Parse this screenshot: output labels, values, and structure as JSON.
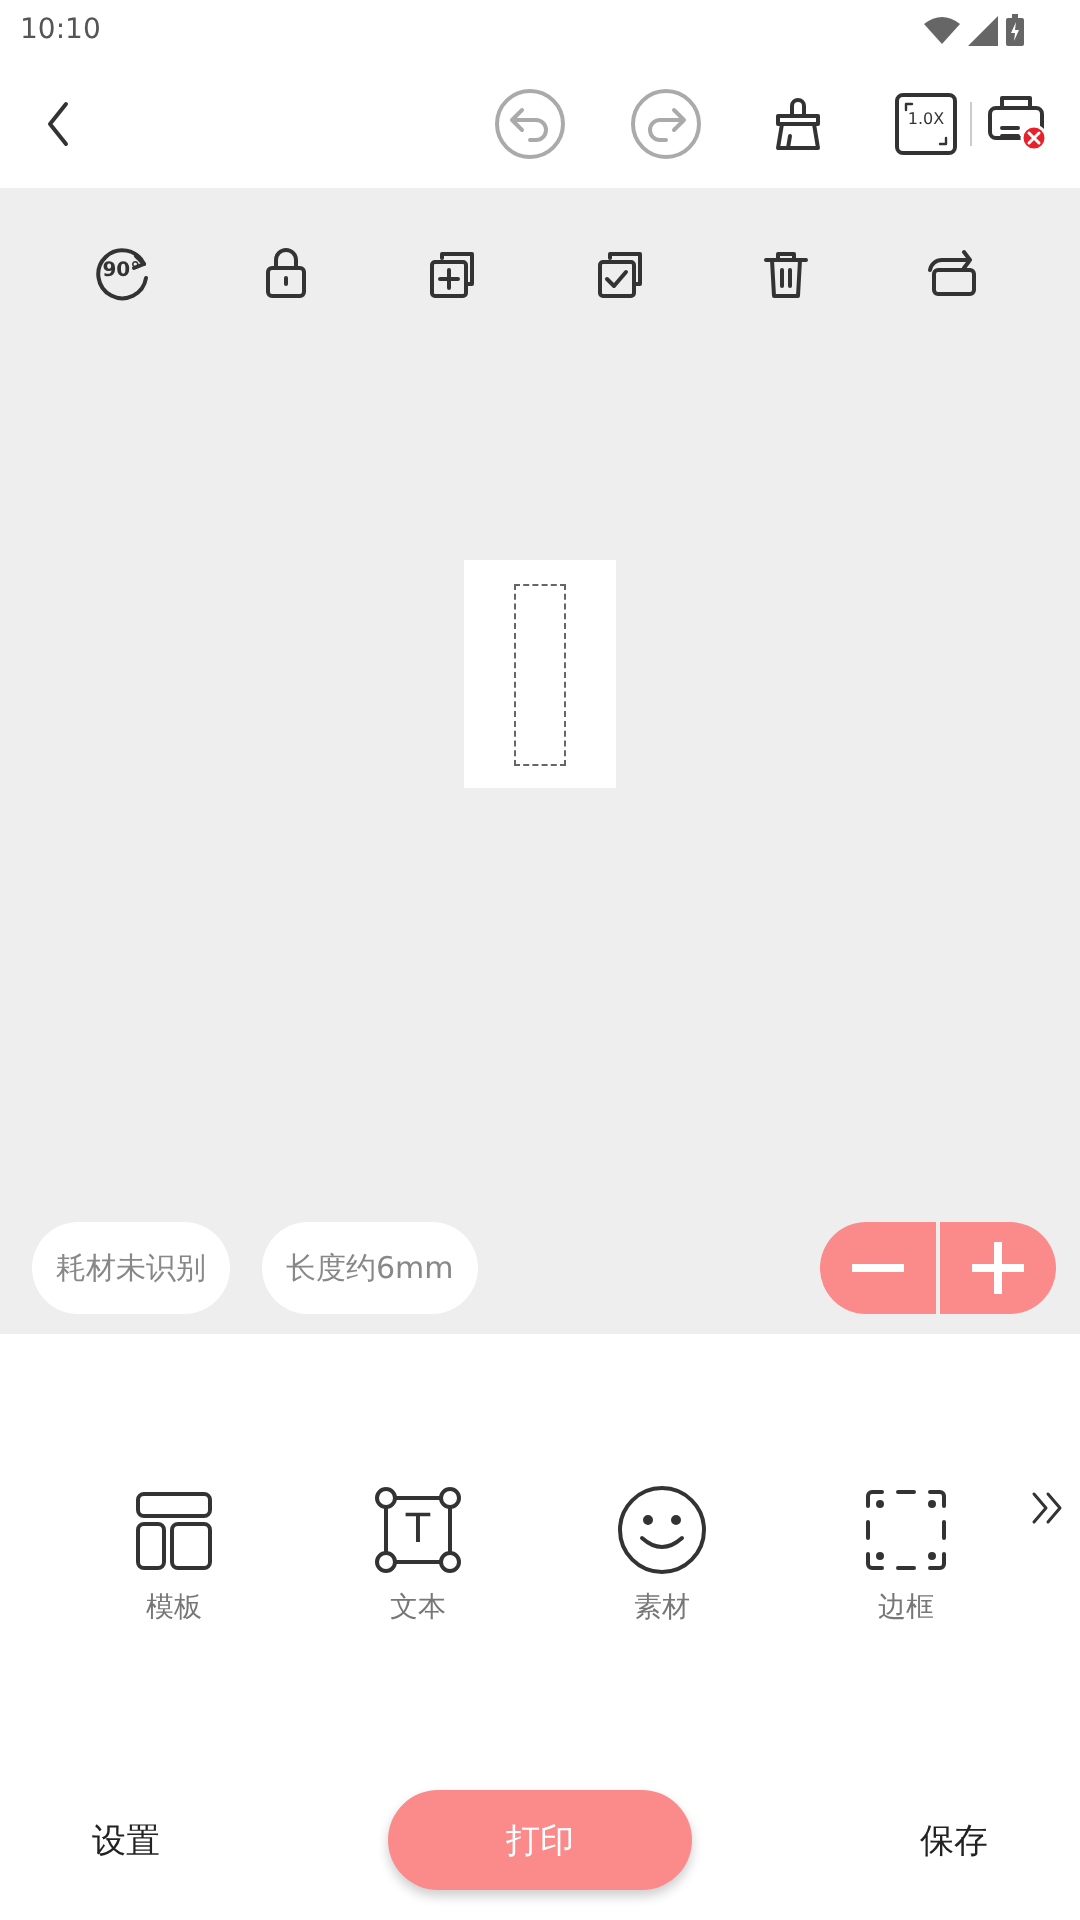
{
  "status_bar": {
    "time": "10:10"
  },
  "toolbar": {
    "zoom_label": "1.0X"
  },
  "canvas_tools": {
    "rotate_label": "90°"
  },
  "chips": [
    "耗材未识别",
    "长度约6mm"
  ],
  "tools": [
    {
      "kind": "template",
      "label": "模板"
    },
    {
      "kind": "text",
      "label": "文本",
      "icon_text": "T"
    },
    {
      "kind": "material",
      "label": "素材"
    },
    {
      "kind": "border",
      "label": "边框"
    }
  ],
  "bottom_bar": {
    "settings": "设置",
    "print": "打印",
    "save": "保存"
  }
}
